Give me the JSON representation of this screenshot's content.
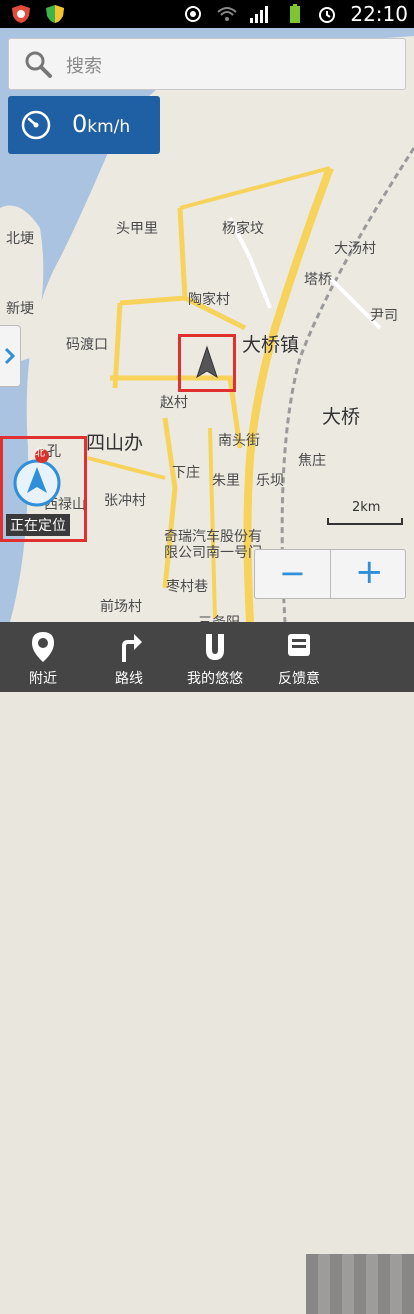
{
  "status_bar": {
    "time": "22:10",
    "signal": "3G"
  },
  "search": {
    "placeholder": "搜索"
  },
  "speed": {
    "value": "0",
    "unit": "km/h"
  },
  "map": {
    "labels": {
      "beigeng": "北埂",
      "xingeng": "新埂",
      "toujiali": "头甲里",
      "yangjiaqi": "杨家坟",
      "datangcun": "大汤村",
      "tacao": "塔桥",
      "taojiacun": "陶家村",
      "yincun": "尹司",
      "madukou": "码渡口",
      "daqiaozhen": "大桥镇",
      "zhaocun": "赵村",
      "daqiao": "大桥",
      "sishanban": "四山办",
      "nantoujie": "南头街",
      "jiaozhuang": "焦庄",
      "xiazhuang": "下庄",
      "zhuli": "朱里",
      "leba": "乐坝",
      "zhangchongcun": "张冲村",
      "chery1": "奇瑞汽车股份有",
      "chery2": "限公司南一号门",
      "zaocunxiang": "枣村巷",
      "qianchangcun": "前场村",
      "sanwuli": "三务阳",
      "xisuo": "西禄山",
      "north": "北",
      "zhangshan": "孔"
    },
    "locating": "正在定位",
    "scale": "2km"
  },
  "zoom": {
    "minus": "−",
    "plus": "+"
  },
  "bottom_tabs": [
    {
      "label": "附近",
      "icon": "location-pin-icon"
    },
    {
      "label": "路线",
      "icon": "route-arrow-icon"
    },
    {
      "label": "我的悠悠",
      "icon": "u-logo-icon"
    },
    {
      "label": "反馈意",
      "icon": "feedback-icon"
    }
  ],
  "colors": {
    "speed_bg": "#1f5fa3",
    "road_yellow": "#f7d35b",
    "water": "#a9c3e0",
    "highlight": "#e03030"
  }
}
